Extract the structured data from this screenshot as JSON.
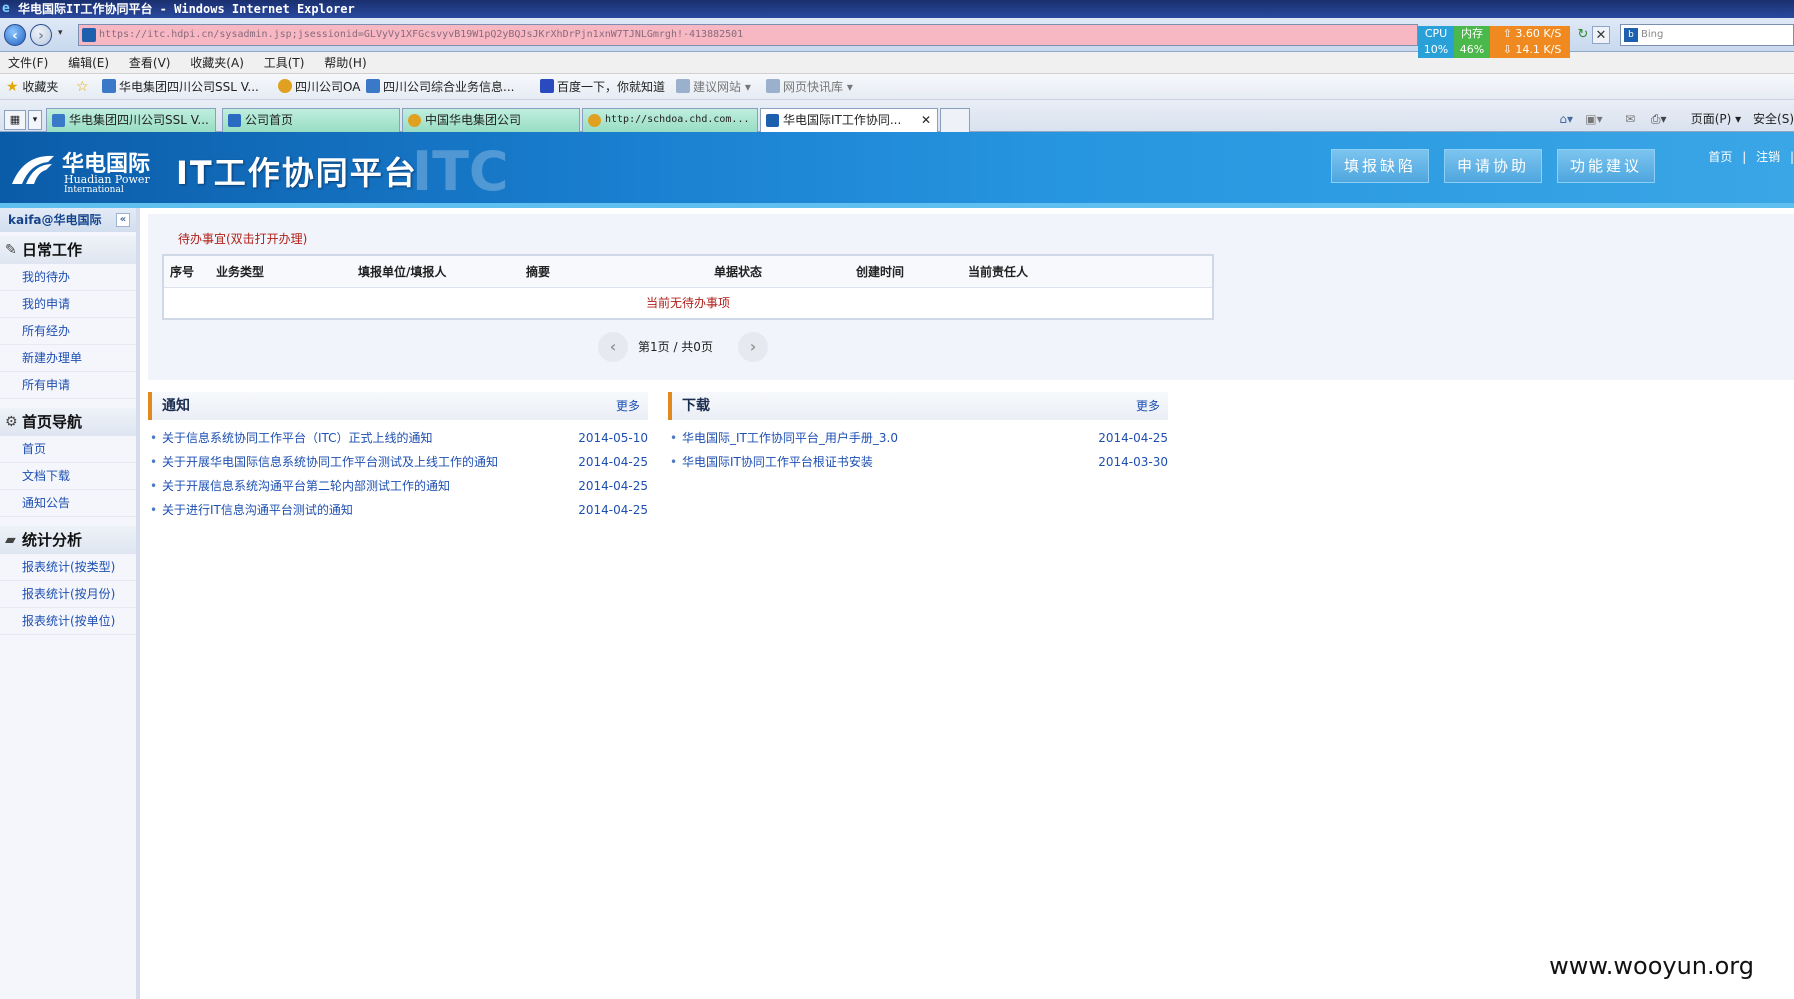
{
  "window": {
    "title": "华电国际IT工作协同平台 - Windows Internet Explorer"
  },
  "address": {
    "url": "https://itc.hdpi.cn/sysadmin.jsp;jsessionid=GLVyVy1XFGcsvyvB19W1pQ2yBQJsJKrXhDrPjn1xnW7TJNLGmrgh!-413882501"
  },
  "cpu_widget": {
    "cpu_label": "CPU",
    "cpu_value": "10%",
    "mem_label": "内存",
    "mem_value": "46%",
    "up_speed": "3.60 K/S",
    "down_speed": "14.1 K/S"
  },
  "search": {
    "placeholder": "Bing"
  },
  "menu": [
    "文件(F)",
    "编辑(E)",
    "查看(V)",
    "收藏夹(A)",
    "工具(T)",
    "帮助(H)"
  ],
  "favorites_bar": {
    "favorites_label": "收藏夹",
    "items": [
      "华电集团四川公司SSL V...",
      "四川公司OA",
      "四川公司综合业务信息...",
      "百度一下，你就知道",
      "建议网站 ▾",
      "网页快讯库 ▾"
    ]
  },
  "tabs": [
    {
      "label": "华电集团四川公司SSL V..."
    },
    {
      "label": "公司首页"
    },
    {
      "label": "中国华电集团公司"
    },
    {
      "label": "http://schdoa.chd.com..."
    },
    {
      "label": "华电国际IT工作协同..."
    }
  ],
  "tab_tools": {
    "page_label": "页面(P) ▾",
    "safety_label": "安全(S)"
  },
  "site": {
    "logo_cn": "华电国际",
    "logo_en_1": "Huadian Power",
    "logo_en_2": "International",
    "title": "IT工作协同平台",
    "watermark": "ITC",
    "buttons": [
      "填报缺陷",
      "申请协助",
      "功能建议"
    ],
    "links": [
      "首页",
      "注销"
    ]
  },
  "sidebar": {
    "user": "kaifa@华电国际",
    "sections": [
      {
        "title": "日常工作",
        "items": [
          "我的待办",
          "我的申请",
          "所有经办",
          "新建办理单",
          "所有申请"
        ]
      },
      {
        "title": "首页导航",
        "items": [
          "首页",
          "文档下载",
          "通知公告"
        ]
      },
      {
        "title": "统计分析",
        "items": [
          "报表统计(按类型)",
          "报表统计(按月份)",
          "报表统计(按单位)"
        ]
      }
    ]
  },
  "todo": {
    "title": "待办事宜(双击打开办理)",
    "columns": [
      "序号",
      "业务类型",
      "填报单位/填报人",
      "摘要",
      "单据状态",
      "创建时间",
      "当前责任人"
    ],
    "empty_text": "当前无待办事项",
    "pager_text": "第1页 / 共0页"
  },
  "notices": {
    "title": "通知",
    "more": "更多",
    "items": [
      {
        "text": "关于信息系统协同工作平台（ITC）正式上线的通知",
        "date": "2014-05-10"
      },
      {
        "text": "关于开展华电国际信息系统协同工作平台测试及上线工作的通知",
        "date": "2014-04-25"
      },
      {
        "text": "关于开展信息系统沟通平台第二轮内部测试工作的通知",
        "date": "2014-04-25"
      },
      {
        "text": "关于进行IT信息沟通平台测试的通知",
        "date": "2014-04-25"
      }
    ]
  },
  "downloads": {
    "title": "下载",
    "more": "更多",
    "items": [
      {
        "text": "华电国际_IT工作协同平台_用户手册_3.0",
        "date": "2014-04-25"
      },
      {
        "text": "华电国际IT协同工作平台根证书安装",
        "date": "2014-03-30"
      }
    ]
  },
  "watermark": "www.wooyun.org"
}
